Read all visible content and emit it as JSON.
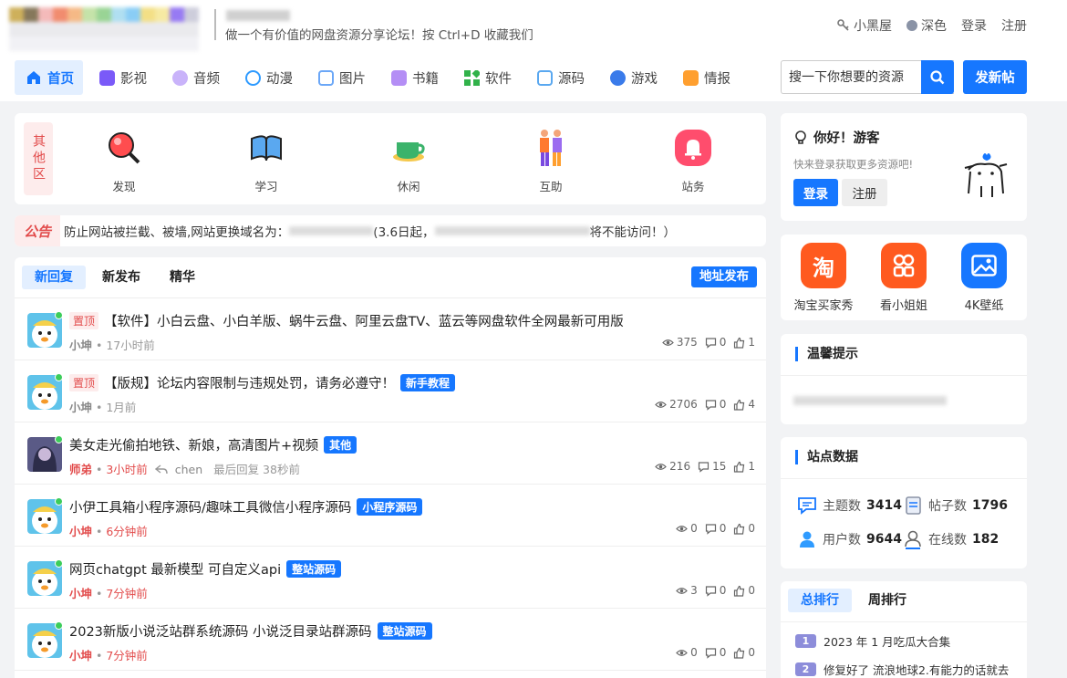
{
  "header": {
    "slogan": "做一个有价值的网盘资源分享论坛！按 Ctrl+D 收藏我们",
    "links": {
      "heiwu": "小黑屋",
      "dark": "深色",
      "login": "登录",
      "register": "注册"
    }
  },
  "nav": {
    "items": [
      {
        "label": "首页",
        "color": "#1677ff"
      },
      {
        "label": "影视",
        "color": "#7a5af8"
      },
      {
        "label": "音频",
        "color": "#b28bf5"
      },
      {
        "label": "动漫",
        "color": "#2f9bff"
      },
      {
        "label": "图片",
        "color": "#6ba7f7"
      },
      {
        "label": "书籍",
        "color": "#9b6cf0"
      },
      {
        "label": "软件",
        "color": "#31b24a"
      },
      {
        "label": "源码",
        "color": "#5aa8f0"
      },
      {
        "label": "游戏",
        "color": "#3a7bea"
      },
      {
        "label": "情报",
        "color": "#ff9f2f"
      }
    ],
    "search_placeholder": "搜一下你想要的资源",
    "post_label": "发新帖"
  },
  "categories": {
    "tag": "其他区",
    "items": [
      {
        "label": "发现",
        "icon": "magnifier-icon"
      },
      {
        "label": "学习",
        "icon": "book-icon"
      },
      {
        "label": "休闲",
        "icon": "cup-icon"
      },
      {
        "label": "互助",
        "icon": "people-icon"
      },
      {
        "label": "站务",
        "icon": "bell-icon"
      }
    ]
  },
  "notice": {
    "label": "公告",
    "text_a": "防止网站被拦截、被墙,网站更换域名为：",
    "text_b": "(3.6日起，",
    "text_c": "将不能访问！）"
  },
  "threads": {
    "tabs": [
      "新回复",
      "新发布",
      "精华"
    ],
    "addr_button": "地址发布",
    "items": [
      {
        "pin": "置顶",
        "title": "【软件】小白云盘、小白羊版、蜗牛云盘、阿里云盘TV、蓝云等网盘软件全网最新可用版",
        "badge": "",
        "author": "小坤",
        "time": "17小时前",
        "reply_user": "",
        "last_reply": "",
        "views": "375",
        "comments": "0",
        "likes": "1",
        "author_red": false
      },
      {
        "pin": "置顶",
        "title": "【版规】论坛内容限制与违规处罚，请务必遵守！",
        "badge": "新手教程",
        "author": "小坤",
        "time": "1月前",
        "reply_user": "",
        "last_reply": "",
        "views": "2706",
        "comments": "0",
        "likes": "4",
        "author_red": false
      },
      {
        "pin": "",
        "title": "美女走光偷拍地铁、新娘，高清图片+视频",
        "badge": "其他",
        "author": "师弟",
        "time": "3小时前",
        "reply_user": "chen",
        "last_reply": "最后回复 38秒前",
        "views": "216",
        "comments": "15",
        "likes": "1",
        "author_red": true
      },
      {
        "pin": "",
        "title": "小伊工具箱小程序源码/趣味工具微信小程序源码",
        "badge": "小程序源码",
        "author": "小坤",
        "time": "6分钟前",
        "reply_user": "",
        "last_reply": "",
        "views": "0",
        "comments": "0",
        "likes": "0",
        "author_red": true
      },
      {
        "pin": "",
        "title": "网页chatgpt 最新模型 可自定义api",
        "badge": "整站源码",
        "author": "小坤",
        "time": "7分钟前",
        "reply_user": "",
        "last_reply": "",
        "views": "3",
        "comments": "0",
        "likes": "0",
        "author_red": true
      },
      {
        "pin": "",
        "title": "2023新版小说泛站群系统源码 小说泛目录站群源码",
        "badge": "整站源码",
        "author": "小坤",
        "time": "7分钟前",
        "reply_user": "",
        "last_reply": "",
        "views": "0",
        "comments": "0",
        "likes": "0",
        "author_red": true
      }
    ]
  },
  "sidebar": {
    "hello": {
      "title": "你好！游客",
      "sub": "快来登录获取更多资源吧!",
      "login": "登录",
      "register": "注册"
    },
    "apps": [
      {
        "label": "淘宝买家秀",
        "glyph": "淘",
        "color": "#ff5a1f"
      },
      {
        "label": "看小姐姐",
        "glyph": "",
        "color": "#ff5a1f"
      },
      {
        "label": "4K壁纸",
        "glyph": "",
        "color": "#1677ff"
      }
    ],
    "tips_title": "温馨提示",
    "stats_title": "站点数据",
    "stats": [
      {
        "label": "主题数",
        "value": "3414"
      },
      {
        "label": "帖子数",
        "value": "1796"
      },
      {
        "label": "用户数",
        "value": "9644"
      },
      {
        "label": "在线数",
        "value": "182"
      }
    ],
    "rank_tabs": [
      "总排行",
      "周排行"
    ],
    "rank": [
      {
        "num": "1",
        "title": "2023 年 1 月吃瓜大合集"
      },
      {
        "num": "2",
        "title": "修复好了 流浪地球2.有能力的话就去"
      }
    ]
  }
}
